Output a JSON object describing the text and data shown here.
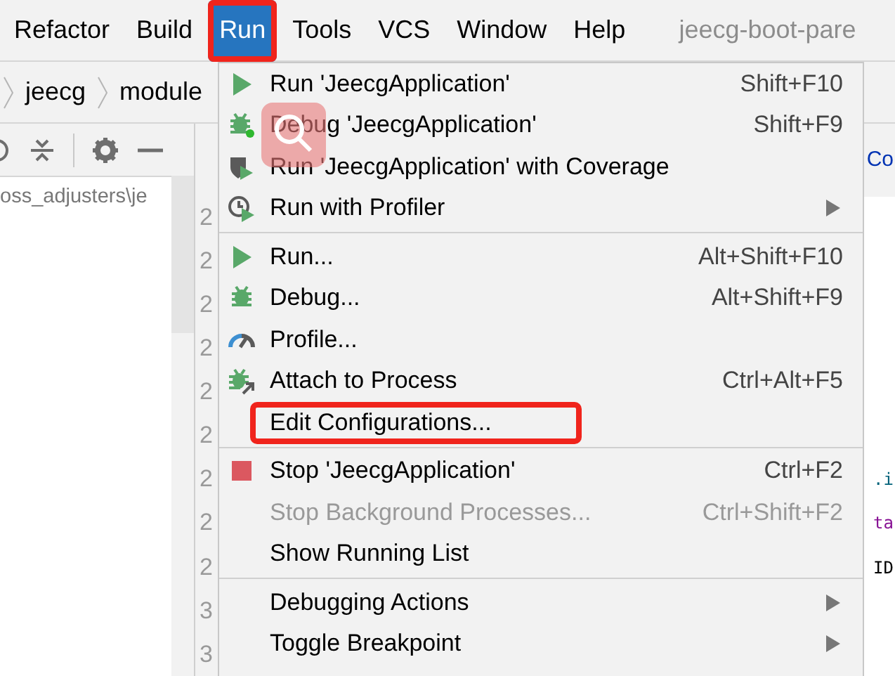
{
  "menubar": {
    "items": [
      {
        "label": "Refactor",
        "selected": false,
        "annotated": false
      },
      {
        "label": "Build",
        "selected": false,
        "annotated": false
      },
      {
        "label": "Run",
        "selected": true,
        "annotated": true
      },
      {
        "label": "Tools",
        "selected": false,
        "annotated": false
      },
      {
        "label": "VCS",
        "selected": false,
        "annotated": false
      },
      {
        "label": "Window",
        "selected": false,
        "annotated": false
      },
      {
        "label": "Help",
        "selected": false,
        "annotated": false
      }
    ],
    "title": "jeecg-boot-pare"
  },
  "breadcrumbs": [
    "jeecg",
    "module"
  ],
  "project_panel": {
    "path": "oss_adjusters\\je"
  },
  "editor": {
    "tab_text": "Co",
    "lines": [
      {
        "number": "2"
      },
      {
        "number": "2"
      },
      {
        "number": "2"
      },
      {
        "number": "2"
      },
      {
        "number": "2"
      },
      {
        "number": "2"
      },
      {
        "number": "2",
        "text": ".i",
        "color": "#00627a"
      },
      {
        "number": "2",
        "text": "ta",
        "color": "#871094"
      },
      {
        "number": "2",
        "text": "ID",
        "color": "#000000"
      },
      {
        "number": "3"
      },
      {
        "number": "3"
      }
    ]
  },
  "run_menu": [
    {
      "kind": "play",
      "label": "Run 'JeecgApplication'",
      "shortcut": "Shift+F10",
      "disabled": false,
      "submenu": false,
      "annotated": false
    },
    {
      "kind": "debug",
      "label": "Debug 'JeecgApplication'",
      "shortcut": "Shift+F9",
      "disabled": false,
      "submenu": false,
      "annotated": false
    },
    {
      "kind": "coverage",
      "label": "Run 'JeecgApplication' with Coverage",
      "disabled": false,
      "submenu": false,
      "annotated": false
    },
    {
      "kind": "profiler",
      "label": "Run with Profiler",
      "disabled": false,
      "submenu": true,
      "annotated": false
    },
    {
      "kind": "separator"
    },
    {
      "kind": "play",
      "label": "Run...",
      "shortcut": "Alt+Shift+F10",
      "disabled": false,
      "submenu": false,
      "annotated": false
    },
    {
      "kind": "bug",
      "label": "Debug...",
      "shortcut": "Alt+Shift+F9",
      "disabled": false,
      "submenu": false,
      "annotated": false
    },
    {
      "kind": "gauge",
      "label": "Profile...",
      "disabled": false,
      "submenu": false,
      "annotated": false
    },
    {
      "kind": "attach",
      "label": "Attach to Process",
      "shortcut": "Ctrl+Alt+F5",
      "disabled": false,
      "submenu": false,
      "annotated": false
    },
    {
      "kind": "plain",
      "label": "Edit Configurations...",
      "disabled": false,
      "submenu": false,
      "annotated": true
    },
    {
      "kind": "separator"
    },
    {
      "kind": "stop",
      "label": "Stop 'JeecgApplication'",
      "shortcut": "Ctrl+F2",
      "disabled": false,
      "submenu": false,
      "annotated": false
    },
    {
      "kind": "plain",
      "label": "Stop Background Processes...",
      "shortcut": "Ctrl+Shift+F2",
      "disabled": true,
      "submenu": false,
      "annotated": false
    },
    {
      "kind": "plain",
      "label": "Show Running List",
      "disabled": false,
      "submenu": false,
      "annotated": false
    },
    {
      "kind": "separator"
    },
    {
      "kind": "plain",
      "label": "Debugging Actions",
      "disabled": false,
      "submenu": true,
      "annotated": false
    },
    {
      "kind": "plain",
      "label": "Toggle Breakpoint",
      "disabled": false,
      "submenu": true,
      "annotated": false
    }
  ]
}
